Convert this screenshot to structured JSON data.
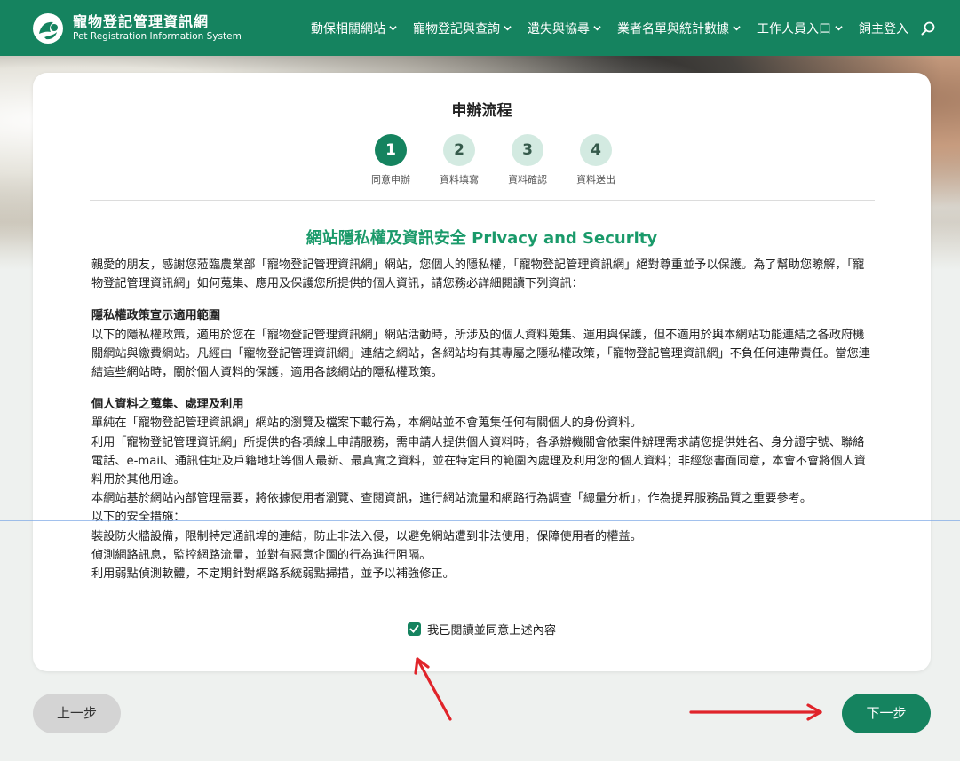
{
  "header": {
    "title": "寵物登記管理資訊網",
    "subtitle": "Pet Registration Information System",
    "menu": [
      {
        "label": "動保相關網站"
      },
      {
        "label": "寵物登記與查詢"
      },
      {
        "label": "遺失與協尋"
      },
      {
        "label": "業者名單與統計數據"
      },
      {
        "label": "工作人員入口"
      },
      {
        "label": "飼主登入"
      }
    ]
  },
  "card": {
    "title": "申辦流程",
    "steps": [
      {
        "num": "1",
        "label": "同意申辦"
      },
      {
        "num": "2",
        "label": "資料填寫"
      },
      {
        "num": "3",
        "label": "資料確認"
      },
      {
        "num": "4",
        "label": "資料送出"
      }
    ],
    "policy_title": "網站隱私權及資訊安全 Privacy and Security",
    "intro": "親愛的朋友，感謝您蒞臨農業部「寵物登記管理資訊網」網站，您個人的隱私權，「寵物登記管理資訊網」絕對尊重並予以保護。為了幫助您瞭解，「寵物登記管理資訊網」如何蒐集、應用及保護您所提供的個人資訊，請您務必詳細閱讀下列資訊：",
    "section1_heading": "隱私權政策宣示適用範圍",
    "section1_body": "以下的隱私權政策，適用於您在「寵物登記管理資訊網」網站活動時，所涉及的個人資料蒐集、運用與保護，但不適用於與本網站功能連結之各政府機關網站與繳費網站。凡經由「寵物登記管理資訊網」連結之網站，各網站均有其專屬之隱私權政策，「寵物登記管理資訊網」不負任何連帶責任。當您連結這些網站時，關於個人資料的保護，適用各該網站的隱私權政策。",
    "section2_heading": "個人資料之蒐集、處理及利用",
    "section2_lines": [
      "單純在「寵物登記管理資訊網」網站的瀏覽及檔案下載行為，本網站並不會蒐集任何有關個人的身份資料。",
      "利用「寵物登記管理資訊網」所提供的各項線上申請服務，需申請人提供個人資料時，各承辦機關會依案件辦理需求請您提供姓名、身分證字號、聯絡電話、e-mail、通訊住址及戶籍地址等個人最新、最真實之資料，並在特定目的範圍內處理及利用您的個人資料；非經您書面同意，本會不會將個人資料用於其他用途。",
      "本網站基於網站內部管理需要，將依據使用者瀏覽、查閱資訊，進行網站流量和網路行為調查「總量分析」，作為提昇服務品質之重要參考。",
      "以下的安全措施：",
      "裝設防火牆設備，限制特定通訊埠的連結，防止非法入侵，以避免網站遭到非法使用，保障使用者的權益。",
      "偵測網路訊息，監控網路流量，並對有惡意企圖的行為進行阻隔。",
      "利用弱點偵測軟體，不定期針對網路系統弱點掃描，並予以補強修正。"
    ],
    "agree_label": "我已閱讀並同意上述內容"
  },
  "buttons": {
    "prev": "上一步",
    "next": "下一步"
  },
  "colors": {
    "brand": "#15835f",
    "accent_text": "#1a9a6a",
    "annotation_arrow": "#e0242a"
  }
}
